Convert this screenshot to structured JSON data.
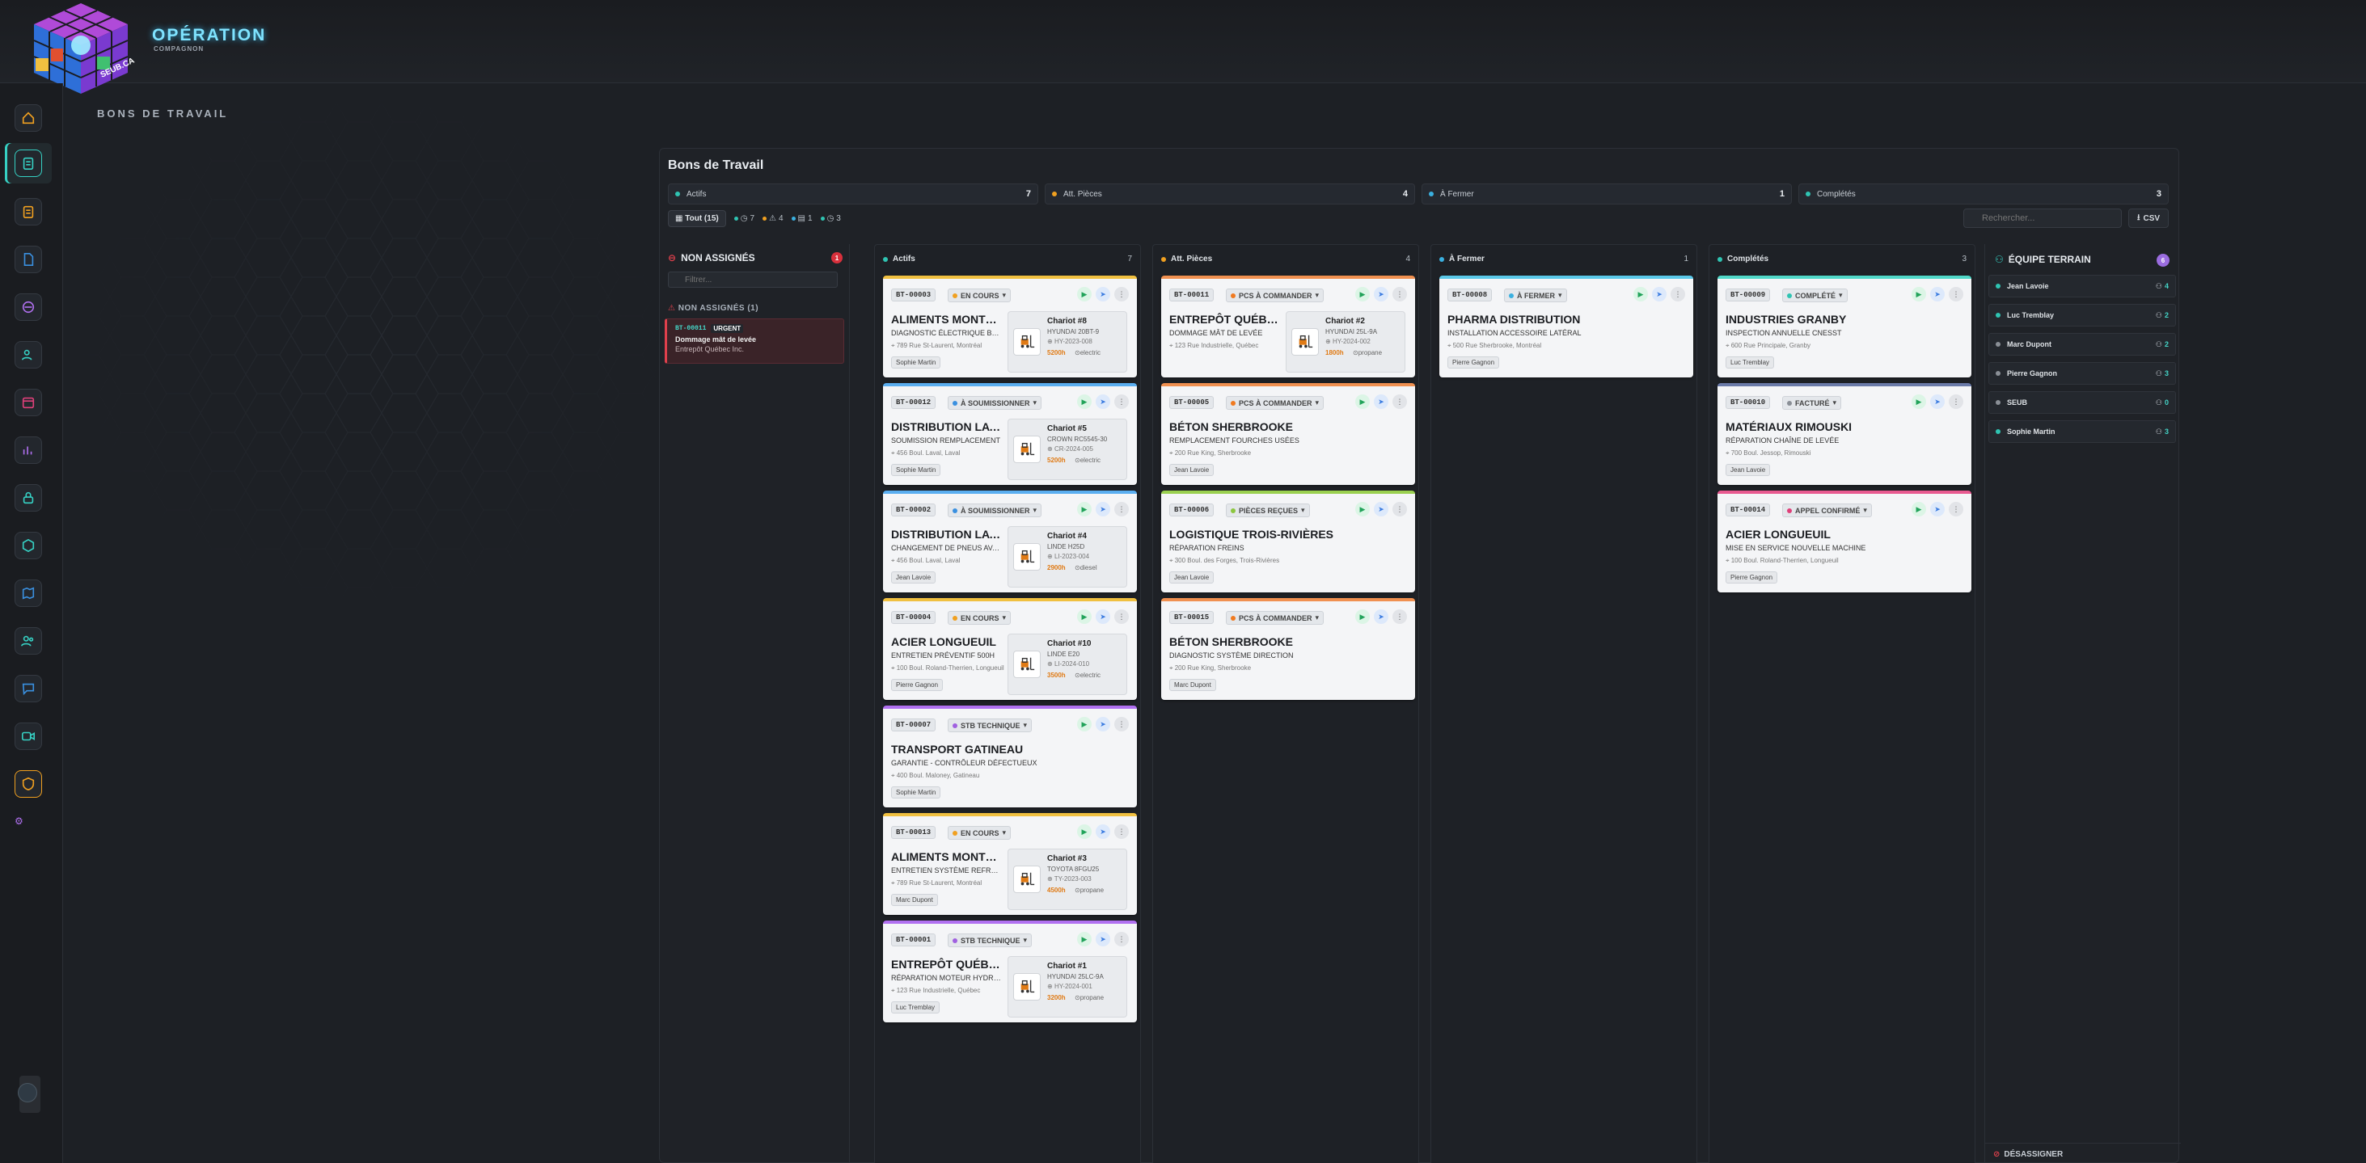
{
  "brand": {
    "title": "OPÉRATION",
    "subtitle": "COMPAGNON",
    "logo_text": "SEUB.CA"
  },
  "page": {
    "title": "BONS DE TRAVAIL"
  },
  "nav": [
    "home-icon",
    "clipboard-icon",
    "list-icon",
    "document-icon",
    "palette-icon",
    "users-icon",
    "calendar-icon",
    "chart-icon",
    "lock-icon",
    "package-icon",
    "map-icon",
    "team-icon",
    "chat-icon",
    "video-icon",
    "shield-icon"
  ],
  "board": {
    "title": "Bons de Travail",
    "stats": [
      {
        "label": "Actifs",
        "count": "7",
        "color": "#2fc4b2"
      },
      {
        "label": "Att. Pièces",
        "count": "4",
        "color": "#f0a020"
      },
      {
        "label": "À Fermer",
        "count": "1",
        "color": "#3ab0e0"
      },
      {
        "label": "Complétés",
        "count": "3",
        "color": "#2fc4b2"
      }
    ],
    "filters": {
      "all": "Tout (15)",
      "chips": [
        "7",
        "4",
        "1",
        "3"
      ]
    },
    "search_placeholder": "Rechercher...",
    "csv_label": "CSV"
  },
  "unassigned": {
    "title": "NON ASSIGNÉS",
    "count": "1",
    "filter_placeholder": "Filtrer...",
    "section": "NON ASSIGNÉS (1)",
    "card": {
      "id": "BT-00011",
      "priority": "URGENT",
      "title": "Dommage mât de levée",
      "client": "Entrepôt Québec Inc."
    }
  },
  "columns": [
    {
      "title": "Actifs",
      "count": "7",
      "color": "#2fc4b2",
      "cards": [
        {
          "id": "BT-00003",
          "status": "EN COURS",
          "status_color": "#f0a020",
          "accent": "#f0c040",
          "client": "ALIMENTS MONTRÉAL",
          "type": "DIAGNOSTIC ÉLECTRIQUE BATTERIE",
          "address": "789 Rue St-Laurent, Montréal",
          "tech": "Sophie Martin",
          "eq": {
            "name": "Chariot #8",
            "model": "HYUNDAI 20BT-9",
            "serial": "HY-2023-008",
            "hours": "5200h",
            "fuel": "electric"
          }
        },
        {
          "id": "BT-00012",
          "status": "À SOUMISSIONNER",
          "status_color": "#3a90e0",
          "accent": "#5aaef0",
          "client": "DISTRIBUTION LAVAL",
          "type": "SOUMISSION REMPLACEMENT",
          "address": "456 Boul. Laval, Laval",
          "tech": "Sophie Martin",
          "eq": {
            "name": "Chariot #5",
            "model": "CROWN RC5545-30",
            "serial": "CR-2024-005",
            "hours": "5200h",
            "fuel": "electric"
          }
        },
        {
          "id": "BT-00002",
          "status": "À SOUMISSIONNER",
          "status_color": "#3a90e0",
          "accent": "#5aaef0",
          "client": "DISTRIBUTION LAVAL",
          "type": "CHANGEMENT DE PNEUS AVANT",
          "address": "456 Boul. Laval, Laval",
          "tech": "Jean Lavoie",
          "eq": {
            "name": "Chariot #4",
            "model": "LINDE H25D",
            "serial": "LI-2023-004",
            "hours": "2900h",
            "fuel": "diesel"
          }
        },
        {
          "id": "BT-00004",
          "status": "EN COURS",
          "status_color": "#f0a020",
          "accent": "#f0c040",
          "client": "ACIER LONGUEUIL",
          "type": "ENTRETIEN PRÉVENTIF 500H",
          "address": "100 Boul. Roland-Therrien, Longueuil",
          "tech": "Pierre Gagnon",
          "eq": {
            "name": "Chariot #10",
            "model": "LINDE E20",
            "serial": "LI-2024-010",
            "hours": "3500h",
            "fuel": "electric"
          }
        },
        {
          "id": "BT-00007",
          "status": "STB TECHNIQUE",
          "status_color": "#a060e0",
          "accent": "#b070f0",
          "client": "TRANSPORT GATINEAU",
          "type": "GARANTIE - CONTRÔLEUR DÉFECTUEUX",
          "address": "400 Boul. Maloney, Gatineau",
          "tech": "Sophie Martin",
          "eq": null
        },
        {
          "id": "BT-00013",
          "status": "EN COURS",
          "status_color": "#f0a020",
          "accent": "#f0c040",
          "client": "ALIMENTS MONTRÉAL",
          "type": "ENTRETIEN SYSTÈME REFROIDISSEMENT",
          "address": "789 Rue St-Laurent, Montréal",
          "tech": "Marc Dupont",
          "eq": {
            "name": "Chariot #3",
            "model": "TOYOTA 8FGU25",
            "serial": "TY-2023-003",
            "hours": "4500h",
            "fuel": "propane"
          }
        },
        {
          "id": "BT-00001",
          "status": "STB TECHNIQUE",
          "status_color": "#a060e0",
          "accent": "#b070f0",
          "client": "ENTREPÔT QUÉBEC",
          "type": "RÉPARATION MOTEUR HYDRAULIQUE",
          "address": "123 Rue Industrielle, Québec",
          "tech": "Luc Tremblay",
          "eq": {
            "name": "Chariot #1",
            "model": "HYUNDAI 25LC-9A",
            "serial": "HY-2024-001",
            "hours": "3200h",
            "fuel": "propane"
          }
        }
      ]
    },
    {
      "title": "Att. Pièces",
      "count": "4",
      "color": "#f0a020",
      "cards": [
        {
          "id": "BT-00011",
          "status": "PCS À COMMANDER",
          "status_color": "#f07a20",
          "accent": "#f09050",
          "client": "ENTREPÔT QUÉBEC",
          "type": "DOMMAGE MÂT DE LEVÉE",
          "address": "123 Rue Industrielle, Québec",
          "tech": "",
          "eq": {
            "name": "Chariot #2",
            "model": "HYUNDAI 25L-9A",
            "serial": "HY-2024-002",
            "hours": "1800h",
            "fuel": "propane"
          }
        },
        {
          "id": "BT-00005",
          "status": "PCS À COMMANDER",
          "status_color": "#f07a20",
          "accent": "#f09050",
          "client": "BÉTON SHERBROOKE",
          "type": "REMPLACEMENT FOURCHES USÉES",
          "address": "200 Rue King, Sherbrooke",
          "tech": "Jean Lavoie",
          "eq": null
        },
        {
          "id": "BT-00006",
          "status": "PIÈCES REÇUES",
          "status_color": "#8cc63f",
          "accent": "#9ad050",
          "client": "LOGISTIQUE TROIS-RIVIÈRES",
          "type": "RÉPARATION FREINS",
          "address": "300 Boul. des Forges, Trois-Rivières",
          "tech": "Jean Lavoie",
          "eq": null
        },
        {
          "id": "BT-00015",
          "status": "PCS À COMMANDER",
          "status_color": "#f07a20",
          "accent": "#f09050",
          "client": "BÉTON SHERBROOKE",
          "type": "DIAGNOSTIC SYSTÈME DIRECTION",
          "address": "200 Rue King, Sherbrooke",
          "tech": "Marc Dupont",
          "eq": null
        }
      ]
    },
    {
      "title": "À Fermer",
      "count": "1",
      "color": "#3ab0e0",
      "cards": [
        {
          "id": "BT-00008",
          "status": "À FERMER",
          "status_color": "#3ab0e0",
          "accent": "#5ac8e8",
          "client": "PHARMA DISTRIBUTION",
          "type": "INSTALLATION ACCESSOIRE LATÉRAL",
          "address": "500 Rue Sherbrooke, Montréal",
          "tech": "Pierre Gagnon",
          "eq": null
        }
      ]
    },
    {
      "title": "Complétés",
      "count": "3",
      "color": "#2fc4b2",
      "cards": [
        {
          "id": "BT-00009",
          "status": "COMPLÉTÉ",
          "status_color": "#2fc4b2",
          "accent": "#50d8c8",
          "client": "INDUSTRIES GRANBY",
          "type": "INSPECTION ANNUELLE CNESST",
          "address": "600 Rue Principale, Granby",
          "tech": "Luc Tremblay",
          "eq": null
        },
        {
          "id": "BT-00010",
          "status": "FACTURÉ",
          "status_color": "#8a8f96",
          "accent": "#6a7aa8",
          "client": "MATÉRIAUX RIMOUSKI",
          "type": "RÉPARATION CHAÎNE DE LEVÉE",
          "address": "700 Boul. Jessop, Rimouski",
          "tech": "Jean Lavoie",
          "eq": null
        },
        {
          "id": "BT-00014",
          "status": "APPEL CONFIRMÉ",
          "status_color": "#e0407a",
          "accent": "#e85a90",
          "client": "ACIER LONGUEUIL",
          "type": "MISE EN SERVICE NOUVELLE MACHINE",
          "address": "100 Boul. Roland-Therrien, Longueuil",
          "tech": "Pierre Gagnon",
          "eq": null
        }
      ]
    }
  ],
  "team": {
    "title": "ÉQUIPE TERRAIN",
    "count": "6",
    "members": [
      {
        "name": "Jean Lavoie",
        "count": "4",
        "color": "#2fc4b2"
      },
      {
        "name": "Luc Tremblay",
        "count": "2",
        "color": "#2fc4b2"
      },
      {
        "name": "Marc Dupont",
        "count": "2",
        "color": "#8a8f96"
      },
      {
        "name": "Pierre Gagnon",
        "count": "3",
        "color": "#8a8f96"
      },
      {
        "name": "SEUB",
        "count": "0",
        "color": "#8a8f96"
      },
      {
        "name": "Sophie Martin",
        "count": "3",
        "color": "#2fc4b2"
      }
    ],
    "footer": "DÉSASSIGNER"
  }
}
